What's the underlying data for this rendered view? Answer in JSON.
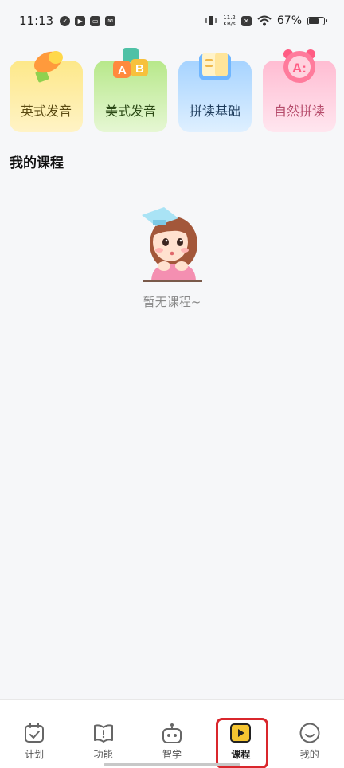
{
  "status_bar": {
    "time": "11:13",
    "net_speed_value": "11.2",
    "net_speed_unit": "KB/s",
    "battery_percent": "67%"
  },
  "categories": [
    {
      "label": "英式发音",
      "icon": "megaphone-icon",
      "color": "#fde889"
    },
    {
      "label": "美式发音",
      "icon": "abc-blocks-icon",
      "color": "#b7e88a"
    },
    {
      "label": "拼读基础",
      "icon": "book-icon",
      "color": "#a6d3ff"
    },
    {
      "label": "自然拼读",
      "icon": "alarm-clock-icon",
      "color": "#ffbcd2"
    }
  ],
  "section": {
    "title": "我的课程"
  },
  "empty_state": {
    "text": "暂无课程~",
    "illustration": "girl-thinking-illustration"
  },
  "bottom_nav": {
    "active_index": 3,
    "items": [
      {
        "label": "计划",
        "icon": "calendar-check-icon"
      },
      {
        "label": "功能",
        "icon": "book-info-icon"
      },
      {
        "label": "智学",
        "icon": "robot-icon"
      },
      {
        "label": "课程",
        "icon": "play-icon"
      },
      {
        "label": "我的",
        "icon": "smile-icon"
      }
    ],
    "highlight_color": "#d9262c",
    "active_icon_color": "#f5c531"
  }
}
